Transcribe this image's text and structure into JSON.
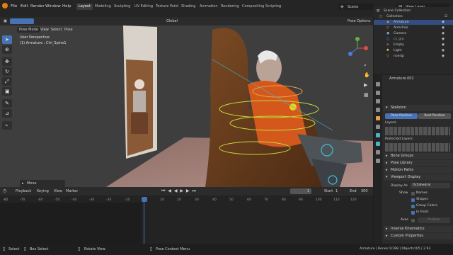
{
  "menu": [
    "File",
    "Edit",
    "Render",
    "Window",
    "Help"
  ],
  "workspaces": [
    "Layout",
    "Modeling",
    "Sculpting",
    "UV Editing",
    "Texture Paint",
    "Shading",
    "Animation",
    "Rendering",
    "Compositing",
    "Scripting"
  ],
  "scene_label": "Scene",
  "view_layer_label": "View Layer",
  "viewport_header": {
    "mode": "Pose Mode",
    "menus": [
      "View",
      "Select",
      "Pose"
    ],
    "orientation": "Global",
    "pose_options": "Pose Options"
  },
  "overlay": {
    "view_name": "User Perspective",
    "object_info": "(1) Armature : Ctrl_Spine1"
  },
  "move_panel": "Move",
  "timeline": {
    "menus": [
      "Playback",
      "Keying",
      "View",
      "Marker"
    ],
    "current_frame": "1",
    "start_label": "Start",
    "start_value": "1",
    "end_label": "End",
    "end_value": "300",
    "ticks": [
      "-80",
      "-70",
      "-60",
      "-50",
      "-40",
      "-30",
      "-20",
      "-10",
      "0",
      "1",
      "10",
      "20",
      "30",
      "40",
      "50",
      "60",
      "70",
      "80",
      "90",
      "100",
      "110",
      "120"
    ]
  },
  "outliner": {
    "root": "Scene Collection",
    "collection": "Collection",
    "items": [
      "Armature",
      "Armchair",
      "Camera",
      "cs_grp",
      "Empty",
      "Light",
      "ncesip"
    ]
  },
  "properties": {
    "object_name": "Armature.001",
    "skeleton_header": "Skeleton",
    "pose_position": "Pose Position",
    "rest_position": "Rest Position",
    "layers_label": "Layers:",
    "protected_label": "Protected Layers:",
    "sections": [
      "Bone Groups",
      "Pose Library",
      "Motion Paths",
      "Viewport Display"
    ],
    "display_as_label": "Display As",
    "display_as_value": "Octahedral",
    "show_label": "Show",
    "show_options": [
      "Names",
      "Shapes",
      "Group Colors",
      "In Front"
    ],
    "axes_label": "Axes",
    "axes_value": "Position",
    "lower_sections": [
      "Inverse Kinematics",
      "Custom Properties"
    ]
  },
  "status": {
    "select": "Select",
    "box_select": "Box Select",
    "rotate_view": "Rotate View",
    "context_menu": "Pose Context Menu",
    "stats": "Armature | Bones:1/188 | Objects:0/5 | 2.93"
  },
  "colors": {
    "accent": "#4772b3",
    "selection": "#334d80",
    "playhead": "#4772b3"
  }
}
